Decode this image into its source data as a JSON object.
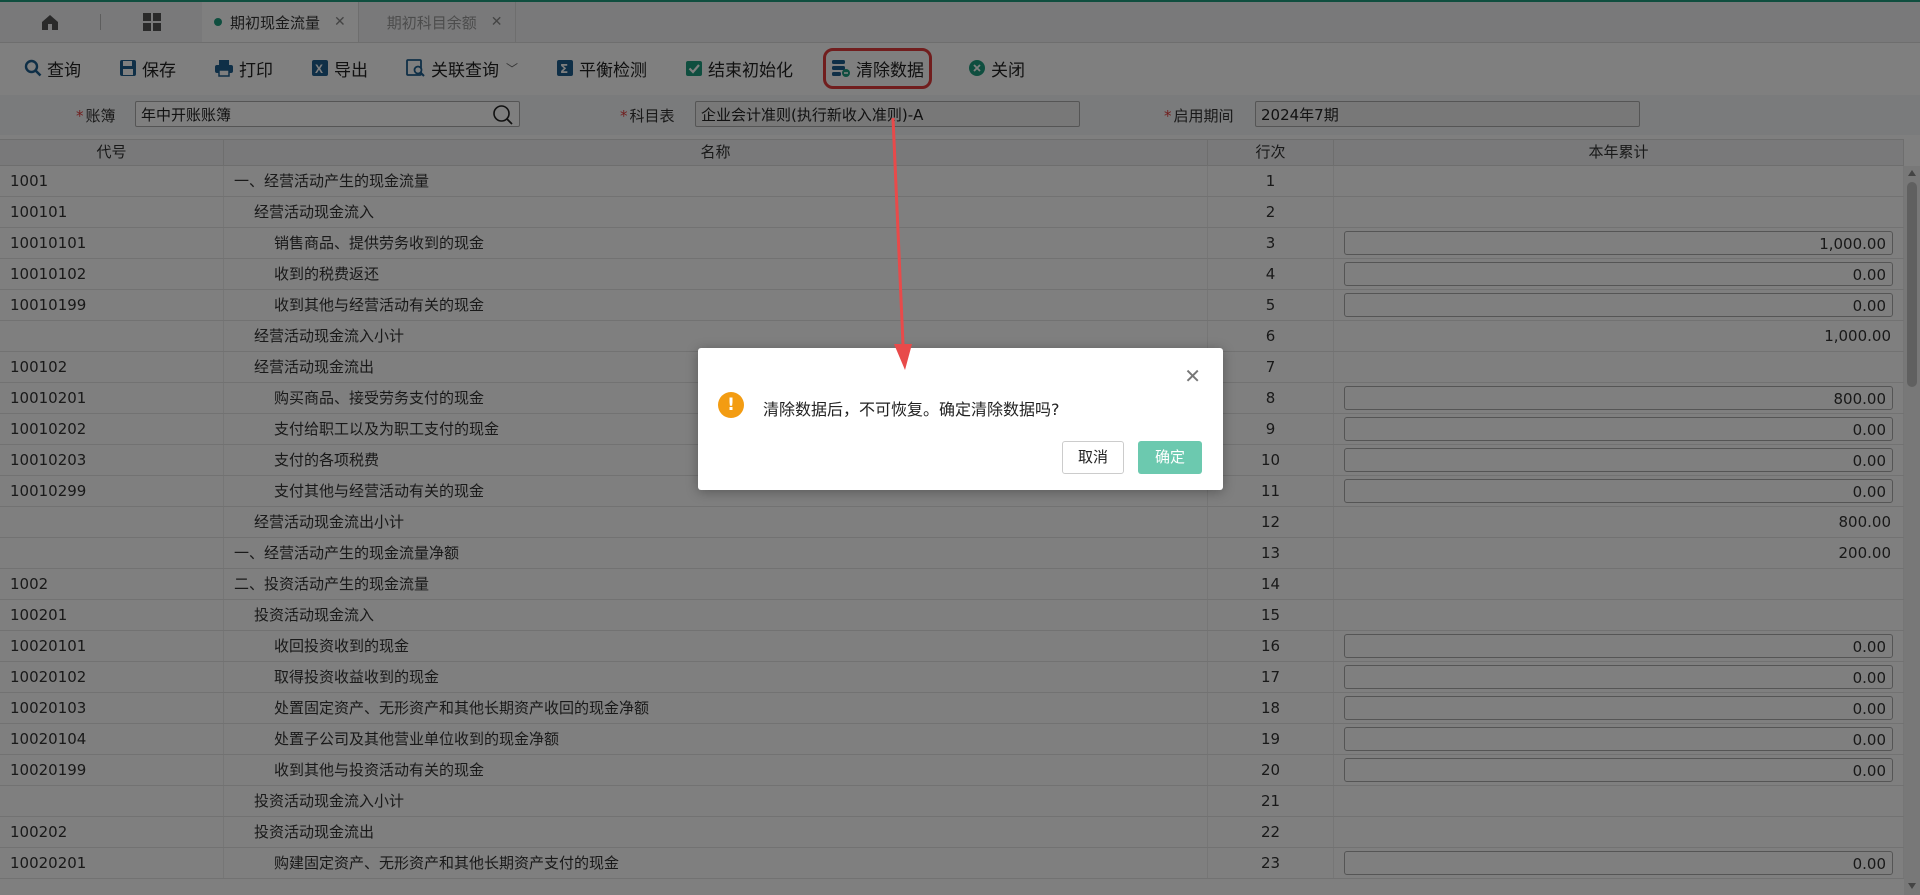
{
  "tabs": [
    {
      "label": "期初现金流量",
      "active": true
    },
    {
      "label": "期初科目余额",
      "active": false
    }
  ],
  "toolbar": {
    "query": "查询",
    "save": "保存",
    "print": "打印",
    "export": "导出",
    "related_query": "关联查询",
    "balance_check": "平衡检测",
    "finish_init": "结束初始化",
    "clear_data": "清除数据",
    "close": "关闭"
  },
  "filters": {
    "ledger_label": "账簿",
    "ledger_value": "年中开账账簿",
    "subject_label": "科目表",
    "subject_value": "企业会计准则(执行新收入准则)-A",
    "period_label": "启用期间",
    "period_value": "2024年7期",
    "required_mark": "*"
  },
  "table": {
    "headers": {
      "code": "代号",
      "name": "名称",
      "line": "行次",
      "ytd": "本年累计"
    },
    "rows": [
      {
        "code": "1001",
        "name": "一、经营活动产生的现金流量",
        "line": "1",
        "amount": "",
        "indent": 0,
        "input": false
      },
      {
        "code": "100101",
        "name": "经营活动现金流入",
        "line": "2",
        "amount": "",
        "indent": 1,
        "input": false
      },
      {
        "code": "10010101",
        "name": "销售商品、提供劳务收到的现金",
        "line": "3",
        "amount": "1,000.00",
        "indent": 2,
        "input": true
      },
      {
        "code": "10010102",
        "name": "收到的税费返还",
        "line": "4",
        "amount": "0.00",
        "indent": 2,
        "input": true
      },
      {
        "code": "10010199",
        "name": "收到其他与经营活动有关的现金",
        "line": "5",
        "amount": "0.00",
        "indent": 2,
        "input": true
      },
      {
        "code": "",
        "name": "经营活动现金流入小计",
        "line": "6",
        "amount": "1,000.00",
        "indent": 1,
        "input": false
      },
      {
        "code": "100102",
        "name": "经营活动现金流出",
        "line": "7",
        "amount": "",
        "indent": 1,
        "input": false
      },
      {
        "code": "10010201",
        "name": "购买商品、接受劳务支付的现金",
        "line": "8",
        "amount": "800.00",
        "indent": 2,
        "input": true
      },
      {
        "code": "10010202",
        "name": "支付给职工以及为职工支付的现金",
        "line": "9",
        "amount": "0.00",
        "indent": 2,
        "input": true
      },
      {
        "code": "10010203",
        "name": "支付的各项税费",
        "line": "10",
        "amount": "0.00",
        "indent": 2,
        "input": true
      },
      {
        "code": "10010299",
        "name": "支付其他与经营活动有关的现金",
        "line": "11",
        "amount": "0.00",
        "indent": 2,
        "input": true
      },
      {
        "code": "",
        "name": "经营活动现金流出小计",
        "line": "12",
        "amount": "800.00",
        "indent": 1,
        "input": false
      },
      {
        "code": "",
        "name": "一、经营活动产生的现金流量净额",
        "line": "13",
        "amount": "200.00",
        "indent": 0,
        "input": false
      },
      {
        "code": "1002",
        "name": "二、投资活动产生的现金流量",
        "line": "14",
        "amount": "",
        "indent": 0,
        "input": false
      },
      {
        "code": "100201",
        "name": "投资活动现金流入",
        "line": "15",
        "amount": "",
        "indent": 1,
        "input": false
      },
      {
        "code": "10020101",
        "name": "收回投资收到的现金",
        "line": "16",
        "amount": "0.00",
        "indent": 2,
        "input": true
      },
      {
        "code": "10020102",
        "name": "取得投资收益收到的现金",
        "line": "17",
        "amount": "0.00",
        "indent": 2,
        "input": true
      },
      {
        "code": "10020103",
        "name": "处置固定资产、无形资产和其他长期资产收回的现金净额",
        "line": "18",
        "amount": "0.00",
        "indent": 2,
        "input": true
      },
      {
        "code": "10020104",
        "name": "处置子公司及其他营业单位收到的现金净额",
        "line": "19",
        "amount": "0.00",
        "indent": 2,
        "input": true
      },
      {
        "code": "10020199",
        "name": "收到其他与投资活动有关的现金",
        "line": "20",
        "amount": "0.00",
        "indent": 2,
        "input": true
      },
      {
        "code": "",
        "name": "投资活动现金流入小计",
        "line": "21",
        "amount": "",
        "indent": 1,
        "input": false
      },
      {
        "code": "100202",
        "name": "投资活动现金流出",
        "line": "22",
        "amount": "",
        "indent": 1,
        "input": false
      },
      {
        "code": "10020201",
        "name": "购建固定资产、无形资产和其他长期资产支付的现金",
        "line": "23",
        "amount": "0.00",
        "indent": 2,
        "input": true
      }
    ]
  },
  "dialog": {
    "message": "清除数据后，不可恢复。确定清除数据吗?",
    "cancel": "取消",
    "confirm": "确定",
    "warn_glyph": "!"
  },
  "colors": {
    "accent": "#1f9d7e",
    "confirm_button": "#6cc9af",
    "annotation": "#e23d3d",
    "warning": "#f39c12"
  }
}
